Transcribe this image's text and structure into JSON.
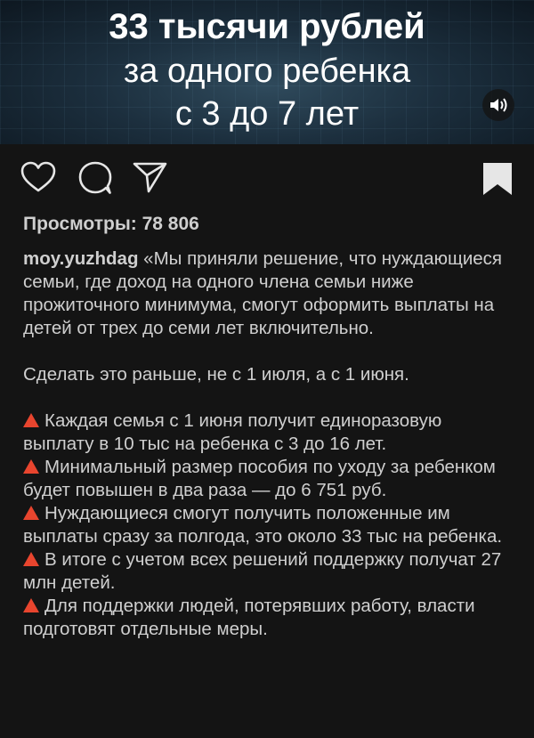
{
  "video": {
    "title_line1": "33 тысячи рублей",
    "title_line2": "за одного ребенка",
    "title_line3": "с 3 до 7 лет"
  },
  "icons": [
    "heart-icon",
    "comment-icon",
    "send-icon",
    "bookmark-icon",
    "speaker-icon",
    "warning-triangle-icon"
  ],
  "colors": {
    "accent_triangle": "#e8452e",
    "panel_bg": "#141414",
    "text": "#cfcfcf"
  },
  "post": {
    "views": "Просмотры: 78 806",
    "username": "moy.yuzhdag",
    "intro": " «Мы приняли решение, что нуждающиеся семьи, где доход на одного члена семьи ниже прожиточного минимума, смогут оформить выплаты на детей от трех до семи лет включительно.",
    "para2": "Сделать это раньше, не с 1 июля, а с 1 июня.",
    "bullets": [
      "Каждая семья с 1 июня получит единоразовую выплату в 10 тыс на ребенка с 3 до 16 лет.",
      "Минимальный размер пособия по уходу за ребенком будет повышен в два раза — до 6 751 руб.",
      "Нуждающиеся смогут получить положенные им выплаты сразу за полгода, это около 33 тыс на ребенка.",
      "В итоге с учетом всех решений поддержку получат 27 млн детей.",
      "Для поддержки людей, потерявших работу, власти подготовят отдельные меры."
    ]
  }
}
